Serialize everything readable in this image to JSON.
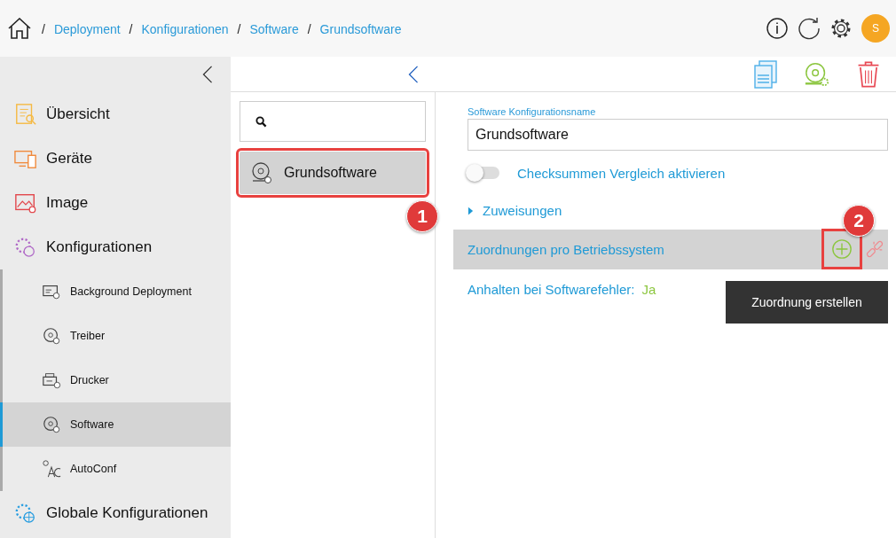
{
  "breadcrumb": {
    "separator": "/",
    "items": [
      {
        "label": "Deployment"
      },
      {
        "label": "Konfigurationen"
      },
      {
        "label": "Software"
      },
      {
        "label": "Grundsoftware"
      }
    ]
  },
  "avatar": "S",
  "sidebar": {
    "items": [
      {
        "label": "Übersicht",
        "kind": "overview",
        "selected": false
      },
      {
        "label": "Geräte",
        "kind": "devices",
        "selected": false
      },
      {
        "label": "Image",
        "kind": "image",
        "selected": false
      },
      {
        "label": "Konfigurationen",
        "kind": "config",
        "selected": false,
        "children": [
          {
            "label": "Background Deployment",
            "kind": "background",
            "selected": false
          },
          {
            "label": "Treiber",
            "kind": "disc",
            "selected": false
          },
          {
            "label": "Drucker",
            "kind": "printer",
            "selected": false
          },
          {
            "label": "Software",
            "kind": "disc",
            "selected": true
          },
          {
            "label": "AutoConf",
            "kind": "autoconf",
            "selected": false
          }
        ]
      },
      {
        "label": "Globale Konfigurationen",
        "kind": "global",
        "selected": false
      }
    ]
  },
  "list": [
    {
      "label": "Grundsoftware",
      "selected": true,
      "callout": "1"
    }
  ],
  "form": {
    "name_label": "Software Konfigurationsname",
    "name_value": "Grundsoftware",
    "toggle": {
      "label": "Checksummen Vergleich aktivieren",
      "on": false
    },
    "section": {
      "label": "Zuweisungen",
      "expanded": false
    },
    "mapping_bar": {
      "label": "Zuordnungen pro Betriebssystem",
      "callout": "2"
    },
    "halt": {
      "label": "Anhalten bei Softwarefehler:",
      "value": "Ja"
    }
  },
  "tooltip": "Zuordnung erstellen"
}
